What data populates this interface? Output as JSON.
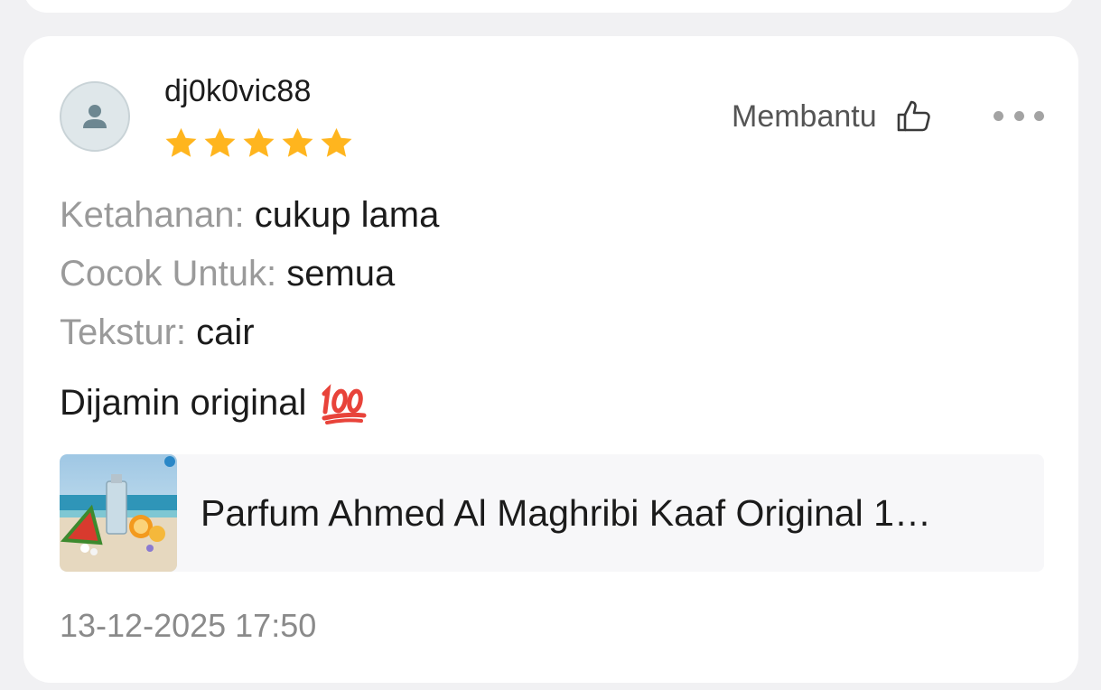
{
  "review": {
    "username": "dj0k0vic88",
    "rating": 5,
    "rating_max": 5,
    "helpful_label": "Membantu",
    "attributes": [
      {
        "key": "Ketahanan:",
        "value": "cukup lama"
      },
      {
        "key": "Cocok Untuk:",
        "value": "semua"
      },
      {
        "key": "Tekstur:",
        "value": "cair"
      }
    ],
    "body": "Dijamin original",
    "body_emoji": "hundred-points-icon",
    "product": {
      "name": "Parfum Ahmed Al Maghribi Kaaf Original 1…",
      "thumbnail": "product-thumbnail"
    },
    "timestamp": "13-12-2025 17:50"
  },
  "colors": {
    "star": "#FFB51E",
    "accent_emoji": "#E8433A",
    "muted_text": "#9A9A9A"
  },
  "icons": [
    "person-icon",
    "star-icon",
    "thumbs-up-icon",
    "more-dots-icon",
    "hundred-points-icon"
  ]
}
